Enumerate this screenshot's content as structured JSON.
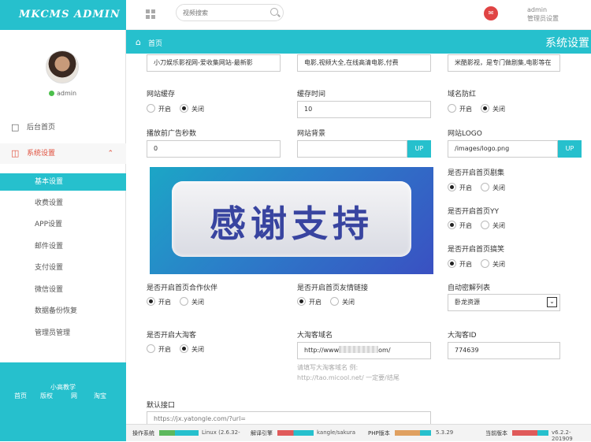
{
  "logo_text": "MKCMS ADMIN",
  "user": {
    "name": "admin"
  },
  "nav": {
    "dashboard": "后台首页",
    "settings": "系统设置",
    "sub": [
      "基本设置",
      "收费设置",
      "APP设置",
      "邮件设置",
      "支付设置",
      "微信设置",
      "数据备份恢复",
      "管理员管理"
    ]
  },
  "footer": {
    "brand": "小高教学",
    "links": [
      "首页",
      "版权",
      "网",
      "淘宝"
    ]
  },
  "topbar": {
    "search_placeholder": "视频搜索",
    "admin_name": "admin",
    "admin_role": "管理员设置"
  },
  "breadcrumb": "首页",
  "section_title": "系统设置",
  "fields": {
    "seo_title": "小刀娱乐影视网-爱收集网站-最新影",
    "seo_keywords": "电影,视频大全,在线高清电影,付费",
    "seo_description": "米酷影视，是专门做剧集,电影等在",
    "site_cache_label": "网站缓存",
    "cache_time_label": "缓存时间",
    "cache_time_value": "10",
    "domain_protect_label": "域名防红",
    "ad_seconds_label": "播放前广告秒数",
    "ad_seconds_value": "0",
    "background_label": "网站背景",
    "logo_label": "网站LOGO",
    "logo_value": "/images/logo.png",
    "upload": "UP",
    "home_series_label": "是否开启首页剧集",
    "home_yy_label": "是否开启首页YY",
    "home_funny_label": "是否开启首页搞笑",
    "home_partner_label": "是否开启首页合作伙伴",
    "home_links_label": "是否开启首页友情链接",
    "auto_parse_label": "自动密解列表",
    "auto_parse_value": "卧龙资源",
    "taoke_label": "是否开启大淘客",
    "taoke_domain_label": "大淘客域名",
    "taoke_domain_value_start": "http://www",
    "taoke_domain_value_end": "om/",
    "taoke_hint_1": "请填写大淘客域名 例:",
    "taoke_hint_2": "http://tao.micool.net/ 一定要/结尾",
    "taoke_id_label": "大淘客ID",
    "taoke_id_value": "774639",
    "default_api_label": "默认接口",
    "default_api_value": "https://jx.yatongle.com/?url=",
    "on": "开启",
    "off": "关闭"
  },
  "banner_text": "感谢支持",
  "statusbar": {
    "os_label": "操作系统",
    "os_value": "Linux (2.6.32-",
    "engine_label": "解译引擎",
    "engine_value": "kangle/sakura",
    "php_label": "PHP版本",
    "php_value": "5.3.29",
    "version_label": "当前版本",
    "version_value": "v6.2.2-201909"
  },
  "colors": {
    "accent": "#26c0cd",
    "danger": "#e04f3c"
  }
}
